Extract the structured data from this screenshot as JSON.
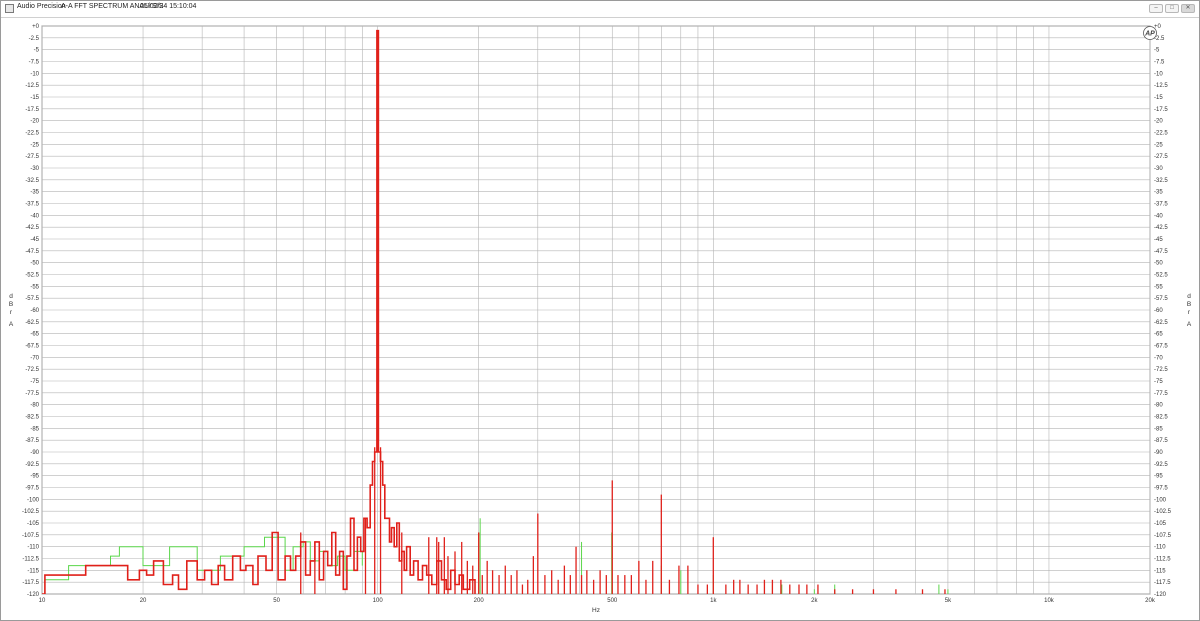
{
  "window": {
    "app_name": "Audio Precision",
    "chart_title": "A-A FFT SPECTRUM ANALYSIS",
    "timestamp": "05/02/24 15:10:04",
    "logo_text": "AP",
    "minimize_label": "–",
    "maximize_label": "□",
    "close_label": "✕"
  },
  "chart_data": {
    "type": "line",
    "title": "A-A FFT SPECTRUM ANALYSIS",
    "xlabel": "Hz",
    "ylabel_left": [
      "d",
      "B",
      "r",
      "A"
    ],
    "ylabel_right": [
      "d",
      "B",
      "r",
      "A"
    ],
    "xscale": "log",
    "xlim": [
      10,
      20000
    ],
    "ylim": [
      -120,
      0
    ],
    "grid": true,
    "x_tick_labels": [
      {
        "v": 10,
        "t": "10"
      },
      {
        "v": 20,
        "t": "20"
      },
      {
        "v": 50,
        "t": "50"
      },
      {
        "v": 100,
        "t": "100"
      },
      {
        "v": 200,
        "t": "200"
      },
      {
        "v": 500,
        "t": "500"
      },
      {
        "v": 1000,
        "t": "1k"
      },
      {
        "v": 2000,
        "t": "2k"
      },
      {
        "v": 5000,
        "t": "5k"
      },
      {
        "v": 10000,
        "t": "10k"
      },
      {
        "v": 20000,
        "t": "20k"
      }
    ],
    "y_tick_labels": [
      "+0",
      "-2.5",
      "-5",
      "-7.5",
      "-10",
      "-12.5",
      "-15",
      "-17.5",
      "-20",
      "-22.5",
      "-25",
      "-27.5",
      "-30",
      "-32.5",
      "-35",
      "-37.5",
      "-40",
      "-42.5",
      "-45",
      "-47.5",
      "-50",
      "-52.5",
      "-55",
      "-57.5",
      "-60",
      "-62.5",
      "-65",
      "-67.5",
      "-70",
      "-72.5",
      "-75",
      "-77.5",
      "-80",
      "-82.5",
      "-85",
      "-87.5",
      "-90",
      "-92.5",
      "-95",
      "-97.5",
      "-100",
      "-102.5",
      "-105",
      "-107.5",
      "-110",
      "-112.5",
      "-115",
      "-117.5",
      "-120"
    ],
    "colors": {
      "series_1": "#e0201a",
      "series_2": "#5ad64a",
      "grid": "#b4b4b4"
    },
    "series": [
      {
        "color": "#5ad64a",
        "style": "step",
        "points": [
          [
            10,
            -120
          ],
          [
            10.2,
            -117
          ],
          [
            12,
            -114
          ],
          [
            14,
            -114
          ],
          [
            16,
            -112
          ],
          [
            17,
            -110
          ],
          [
            19,
            -110
          ],
          [
            20,
            -114
          ],
          [
            22,
            -114
          ],
          [
            24,
            -110
          ],
          [
            27,
            -110
          ],
          [
            29,
            -115
          ],
          [
            32,
            -115
          ],
          [
            34,
            -112
          ],
          [
            37,
            -112
          ],
          [
            40,
            -110
          ],
          [
            43,
            -110
          ],
          [
            46,
            -108
          ],
          [
            50,
            -108
          ],
          [
            53,
            -115
          ],
          [
            56,
            -110
          ],
          [
            60,
            -109
          ],
          [
            63,
            -113
          ],
          [
            67,
            -111
          ],
          [
            71,
            -114
          ],
          [
            76,
            -112
          ],
          [
            80,
            -115
          ],
          [
            85,
            -111
          ],
          [
            90,
            -114
          ]
        ]
      },
      {
        "color": "#e0201a",
        "style": "step",
        "points": [
          [
            10,
            -120
          ],
          [
            10.2,
            -116
          ],
          [
            12,
            -116
          ],
          [
            13.5,
            -114
          ],
          [
            16,
            -114
          ],
          [
            18,
            -117
          ],
          [
            19.5,
            -115
          ],
          [
            20.5,
            -116
          ],
          [
            21.5,
            -113
          ],
          [
            23,
            -118
          ],
          [
            24.5,
            -116
          ],
          [
            25.5,
            -119
          ],
          [
            27,
            -113
          ],
          [
            29,
            -117
          ],
          [
            30.5,
            -115
          ],
          [
            32,
            -118
          ],
          [
            33.5,
            -114
          ],
          [
            35,
            -117
          ],
          [
            37,
            -112
          ],
          [
            39,
            -115
          ],
          [
            40.5,
            -114
          ],
          [
            42.5,
            -118
          ],
          [
            44,
            -112
          ],
          [
            46.5,
            -115
          ],
          [
            48.5,
            -107
          ],
          [
            50.5,
            -117
          ],
          [
            53,
            -112
          ],
          [
            55,
            -115
          ],
          [
            57,
            -112
          ],
          [
            59,
            -109
          ],
          [
            61,
            -116
          ],
          [
            63,
            -113
          ],
          [
            65,
            -109
          ],
          [
            67,
            -117
          ],
          [
            69,
            -111
          ],
          [
            71,
            -114
          ],
          [
            73,
            -107
          ],
          [
            75,
            -116
          ],
          [
            77,
            -111
          ],
          [
            79,
            -119
          ],
          [
            81,
            -112
          ],
          [
            83,
            -104
          ],
          [
            85,
            -115
          ],
          [
            87,
            -108
          ],
          [
            89,
            -111
          ],
          [
            91,
            -104
          ],
          [
            93,
            -106
          ],
          [
            95,
            -97
          ],
          [
            96.5,
            -92
          ],
          [
            98,
            -90
          ],
          [
            99.5,
            -1
          ],
          [
            100.5,
            -90
          ],
          [
            102,
            -92
          ],
          [
            103.5,
            -97
          ],
          [
            105,
            -104
          ],
          [
            107,
            -104
          ],
          [
            108.5,
            -109
          ],
          [
            110,
            -106
          ],
          [
            112,
            -110
          ],
          [
            114,
            -105
          ],
          [
            116,
            -113
          ],
          [
            118,
            -111
          ],
          [
            120,
            -115
          ],
          [
            122,
            -110
          ],
          [
            125,
            -116
          ],
          [
            128,
            -113
          ],
          [
            132,
            -117
          ],
          [
            136,
            -114
          ],
          [
            140,
            -116
          ],
          [
            145,
            -118
          ],
          [
            150,
            -113
          ],
          [
            155,
            -117
          ],
          [
            160,
            -119
          ],
          [
            165,
            -115
          ],
          [
            170,
            -118
          ],
          [
            175,
            -116
          ],
          [
            180,
            -119
          ],
          [
            188,
            -117
          ],
          [
            195,
            -120
          ]
        ]
      }
    ],
    "red_lines": [
      [
        59,
        -107
      ],
      [
        65,
        -109
      ],
      [
        92,
        -104
      ],
      [
        98,
        -89
      ],
      [
        102,
        -89
      ],
      [
        118,
        -107
      ],
      [
        142,
        -108
      ],
      [
        150,
        -108
      ],
      [
        152,
        -109
      ],
      [
        158,
        -108
      ],
      [
        162,
        -112
      ],
      [
        170,
        -111
      ],
      [
        178,
        -109
      ],
      [
        185,
        -113
      ],
      [
        192,
        -114
      ],
      [
        200,
        -107
      ],
      [
        205,
        -116
      ],
      [
        212,
        -113
      ],
      [
        220,
        -115
      ],
      [
        230,
        -116
      ],
      [
        240,
        -114
      ],
      [
        250,
        -116
      ],
      [
        260,
        -115
      ],
      [
        270,
        -118
      ],
      [
        280,
        -117
      ],
      [
        291,
        -112
      ],
      [
        300,
        -103
      ],
      [
        315,
        -116
      ],
      [
        330,
        -115
      ],
      [
        345,
        -117
      ],
      [
        360,
        -114
      ],
      [
        375,
        -116
      ],
      [
        390,
        -110
      ],
      [
        405,
        -116
      ],
      [
        420,
        -115
      ],
      [
        440,
        -117
      ],
      [
        460,
        -115
      ],
      [
        480,
        -116
      ],
      [
        500,
        -96
      ],
      [
        520,
        -116
      ],
      [
        545,
        -116
      ],
      [
        570,
        -116
      ],
      [
        600,
        -113
      ],
      [
        630,
        -117
      ],
      [
        660,
        -113
      ],
      [
        700,
        -99
      ],
      [
        740,
        -117
      ],
      [
        790,
        -114
      ],
      [
        840,
        -114
      ],
      [
        900,
        -118
      ],
      [
        960,
        -118
      ],
      [
        1000,
        -108
      ],
      [
        1090,
        -118
      ],
      [
        1150,
        -117
      ],
      [
        1200,
        -117
      ],
      [
        1270,
        -118
      ],
      [
        1350,
        -118
      ],
      [
        1420,
        -117
      ],
      [
        1500,
        -117
      ],
      [
        1590,
        -117
      ],
      [
        1690,
        -118
      ],
      [
        1800,
        -118
      ],
      [
        1900,
        -118
      ],
      [
        2050,
        -118
      ],
      [
        2300,
        -119
      ],
      [
        2600,
        -119
      ],
      [
        3000,
        -119
      ],
      [
        3500,
        -119
      ],
      [
        4200,
        -119
      ],
      [
        4900,
        -119
      ]
    ],
    "green_lines": [
      [
        202,
        -104
      ],
      [
        405,
        -109
      ],
      [
        498,
        -107
      ],
      [
        700,
        -114
      ],
      [
        800,
        -115
      ],
      [
        1000,
        -116
      ],
      [
        1500,
        -118
      ],
      [
        1600,
        -118
      ],
      [
        2000,
        -119
      ],
      [
        2300,
        -118
      ],
      [
        4700,
        -118
      ],
      [
        5000,
        -119
      ]
    ]
  }
}
